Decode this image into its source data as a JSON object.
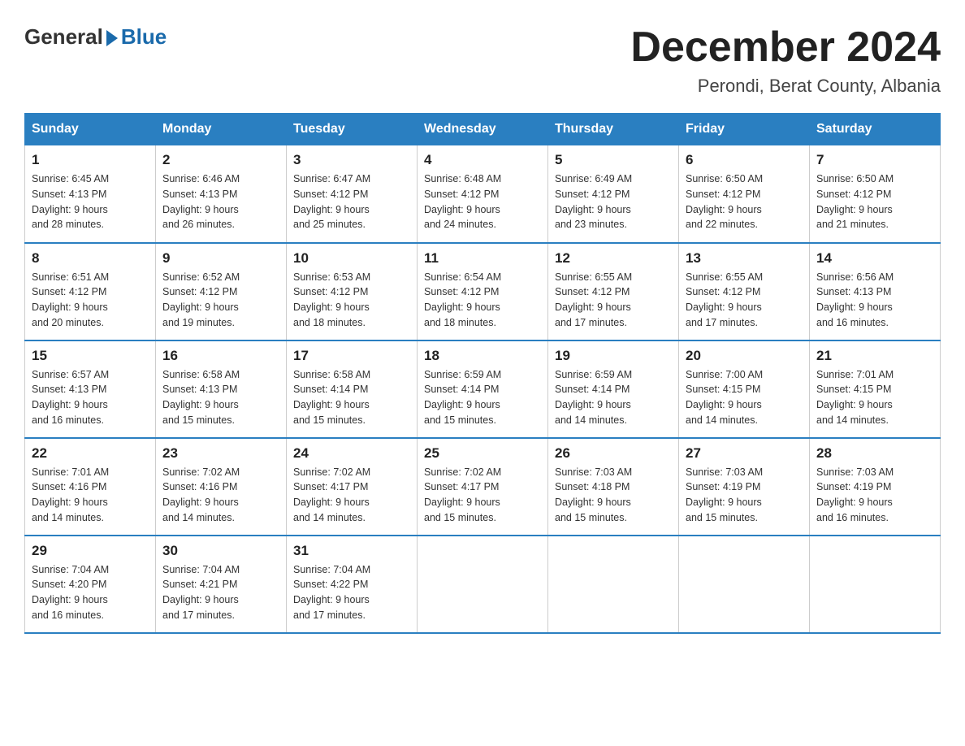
{
  "logo": {
    "general": "General",
    "blue": "Blue"
  },
  "title": "December 2024",
  "subtitle": "Perondi, Berat County, Albania",
  "headers": [
    "Sunday",
    "Monday",
    "Tuesday",
    "Wednesday",
    "Thursday",
    "Friday",
    "Saturday"
  ],
  "weeks": [
    [
      {
        "day": "1",
        "sunrise": "6:45 AM",
        "sunset": "4:13 PM",
        "daylight": "9 hours and 28 minutes."
      },
      {
        "day": "2",
        "sunrise": "6:46 AM",
        "sunset": "4:13 PM",
        "daylight": "9 hours and 26 minutes."
      },
      {
        "day": "3",
        "sunrise": "6:47 AM",
        "sunset": "4:12 PM",
        "daylight": "9 hours and 25 minutes."
      },
      {
        "day": "4",
        "sunrise": "6:48 AM",
        "sunset": "4:12 PM",
        "daylight": "9 hours and 24 minutes."
      },
      {
        "day": "5",
        "sunrise": "6:49 AM",
        "sunset": "4:12 PM",
        "daylight": "9 hours and 23 minutes."
      },
      {
        "day": "6",
        "sunrise": "6:50 AM",
        "sunset": "4:12 PM",
        "daylight": "9 hours and 22 minutes."
      },
      {
        "day": "7",
        "sunrise": "6:50 AM",
        "sunset": "4:12 PM",
        "daylight": "9 hours and 21 minutes."
      }
    ],
    [
      {
        "day": "8",
        "sunrise": "6:51 AM",
        "sunset": "4:12 PM",
        "daylight": "9 hours and 20 minutes."
      },
      {
        "day": "9",
        "sunrise": "6:52 AM",
        "sunset": "4:12 PM",
        "daylight": "9 hours and 19 minutes."
      },
      {
        "day": "10",
        "sunrise": "6:53 AM",
        "sunset": "4:12 PM",
        "daylight": "9 hours and 18 minutes."
      },
      {
        "day": "11",
        "sunrise": "6:54 AM",
        "sunset": "4:12 PM",
        "daylight": "9 hours and 18 minutes."
      },
      {
        "day": "12",
        "sunrise": "6:55 AM",
        "sunset": "4:12 PM",
        "daylight": "9 hours and 17 minutes."
      },
      {
        "day": "13",
        "sunrise": "6:55 AM",
        "sunset": "4:12 PM",
        "daylight": "9 hours and 17 minutes."
      },
      {
        "day": "14",
        "sunrise": "6:56 AM",
        "sunset": "4:13 PM",
        "daylight": "9 hours and 16 minutes."
      }
    ],
    [
      {
        "day": "15",
        "sunrise": "6:57 AM",
        "sunset": "4:13 PM",
        "daylight": "9 hours and 16 minutes."
      },
      {
        "day": "16",
        "sunrise": "6:58 AM",
        "sunset": "4:13 PM",
        "daylight": "9 hours and 15 minutes."
      },
      {
        "day": "17",
        "sunrise": "6:58 AM",
        "sunset": "4:14 PM",
        "daylight": "9 hours and 15 minutes."
      },
      {
        "day": "18",
        "sunrise": "6:59 AM",
        "sunset": "4:14 PM",
        "daylight": "9 hours and 15 minutes."
      },
      {
        "day": "19",
        "sunrise": "6:59 AM",
        "sunset": "4:14 PM",
        "daylight": "9 hours and 14 minutes."
      },
      {
        "day": "20",
        "sunrise": "7:00 AM",
        "sunset": "4:15 PM",
        "daylight": "9 hours and 14 minutes."
      },
      {
        "day": "21",
        "sunrise": "7:01 AM",
        "sunset": "4:15 PM",
        "daylight": "9 hours and 14 minutes."
      }
    ],
    [
      {
        "day": "22",
        "sunrise": "7:01 AM",
        "sunset": "4:16 PM",
        "daylight": "9 hours and 14 minutes."
      },
      {
        "day": "23",
        "sunrise": "7:02 AM",
        "sunset": "4:16 PM",
        "daylight": "9 hours and 14 minutes."
      },
      {
        "day": "24",
        "sunrise": "7:02 AM",
        "sunset": "4:17 PM",
        "daylight": "9 hours and 14 minutes."
      },
      {
        "day": "25",
        "sunrise": "7:02 AM",
        "sunset": "4:17 PM",
        "daylight": "9 hours and 15 minutes."
      },
      {
        "day": "26",
        "sunrise": "7:03 AM",
        "sunset": "4:18 PM",
        "daylight": "9 hours and 15 minutes."
      },
      {
        "day": "27",
        "sunrise": "7:03 AM",
        "sunset": "4:19 PM",
        "daylight": "9 hours and 15 minutes."
      },
      {
        "day": "28",
        "sunrise": "7:03 AM",
        "sunset": "4:19 PM",
        "daylight": "9 hours and 16 minutes."
      }
    ],
    [
      {
        "day": "29",
        "sunrise": "7:04 AM",
        "sunset": "4:20 PM",
        "daylight": "9 hours and 16 minutes."
      },
      {
        "day": "30",
        "sunrise": "7:04 AM",
        "sunset": "4:21 PM",
        "daylight": "9 hours and 17 minutes."
      },
      {
        "day": "31",
        "sunrise": "7:04 AM",
        "sunset": "4:22 PM",
        "daylight": "9 hours and 17 minutes."
      },
      null,
      null,
      null,
      null
    ]
  ],
  "labels": {
    "sunrise": "Sunrise:",
    "sunset": "Sunset:",
    "daylight": "Daylight:"
  }
}
